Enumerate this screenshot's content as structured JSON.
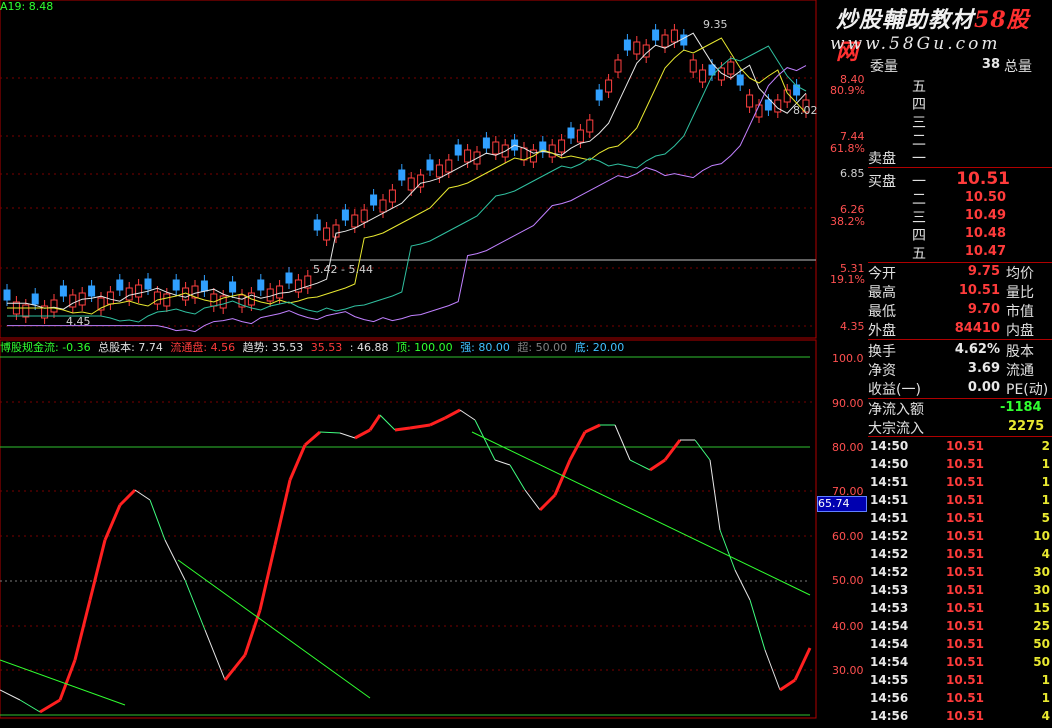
{
  "title_bar": {
    "label": "A19: 8.48"
  },
  "main_chart": {
    "y_labels": [
      {
        "price": "8.40",
        "pct": "80.9%"
      },
      {
        "price": "7.44",
        "pct": "61.8%"
      },
      {
        "price": "6.85",
        "pct": ""
      },
      {
        "price": "6.26",
        "pct": "38.2%"
      },
      {
        "price": "5.31",
        "pct": "19.1%"
      },
      {
        "price": "4.35",
        "pct": ""
      }
    ],
    "annotations": {
      "high": "9.35",
      "right_price": "8.02",
      "low": "4.45",
      "range": "5.42 - 5.44"
    }
  },
  "indicator": {
    "header": [
      {
        "text": "博股规金流: -0.36",
        "color": "#30ff30"
      },
      {
        "text": "总股本: 7.74",
        "color": "#e0e0e0"
      },
      {
        "text": "流通盘: 4.56",
        "color": "#ff3b3b"
      },
      {
        "text": "趋势: 35.53",
        "color": "#e0e0e0"
      },
      {
        "text": "35.53",
        "color": "#ff3b3b"
      },
      {
        "text": ": 46.88",
        "color": "#e0e0e0"
      },
      {
        "text": "顶: 100.00",
        "color": "#30ff30"
      },
      {
        "text": "强: 80.00",
        "color": "#40c0ff"
      },
      {
        "text": "超: 50.00",
        "color": "#808080"
      },
      {
        "text": "底: 20.00",
        "color": "#40c0ff"
      }
    ],
    "y_labels": [
      "100.0",
      "90.00",
      "80.00",
      "70.00",
      "60.00",
      "50.00",
      "40.00",
      "30.00"
    ],
    "current_value": "65.74"
  },
  "logo": {
    "line1_a": "炒股輔助教材",
    "line1_b": "58股网",
    "line2": "www.58Gu.com"
  },
  "order_book": {
    "volume_ratio_label": "委量",
    "volume_ratio_value": "38",
    "total_label": "总量",
    "sell_levels": [
      "五",
      "四",
      "三",
      "二",
      "一"
    ],
    "sell_label": "卖盘",
    "buy_label": "买盘",
    "buy_levels": [
      {
        "level": "一",
        "price": "10.51"
      },
      {
        "level": "二",
        "price": "10.50"
      },
      {
        "level": "三",
        "price": "10.49"
      },
      {
        "level": "四",
        "price": "10.48"
      },
      {
        "level": "五",
        "price": "10.47"
      }
    ]
  },
  "stats": [
    {
      "label": "今开",
      "value": "9.75",
      "right": "均价",
      "color": "red"
    },
    {
      "label": "最高",
      "value": "10.51",
      "right": "量比",
      "color": "red"
    },
    {
      "label": "最低",
      "value": "9.70",
      "right": "市值",
      "color": "red"
    },
    {
      "label": "外盘",
      "value": "84410",
      "right": "内盘",
      "color": "red"
    },
    {
      "label": "换手",
      "value": "4.62%",
      "right": "股本",
      "color": "white"
    },
    {
      "label": "净资",
      "value": "3.69",
      "right": "流通",
      "color": "white"
    },
    {
      "label": "收益(一)",
      "value": "0.00",
      "right": "PE(动)",
      "color": "white"
    }
  ],
  "flows": [
    {
      "label": "净流入额",
      "value": "-1184"
    },
    {
      "label": "大宗流入",
      "value": "2275"
    }
  ],
  "ticks": [
    {
      "time": "14:50",
      "price": "10.51",
      "vol": "2"
    },
    {
      "time": "14:50",
      "price": "10.51",
      "vol": "1"
    },
    {
      "time": "14:51",
      "price": "10.51",
      "vol": "1"
    },
    {
      "time": "14:51",
      "price": "10.51",
      "vol": "1"
    },
    {
      "time": "14:51",
      "price": "10.51",
      "vol": "5"
    },
    {
      "time": "14:52",
      "price": "10.51",
      "vol": "10"
    },
    {
      "time": "14:52",
      "price": "10.51",
      "vol": "4"
    },
    {
      "time": "14:52",
      "price": "10.51",
      "vol": "30"
    },
    {
      "time": "14:53",
      "price": "10.51",
      "vol": "30"
    },
    {
      "time": "14:53",
      "price": "10.51",
      "vol": "15"
    },
    {
      "time": "14:54",
      "price": "10.51",
      "vol": "25"
    },
    {
      "time": "14:54",
      "price": "10.51",
      "vol": "50"
    },
    {
      "time": "14:54",
      "price": "10.51",
      "vol": "50"
    },
    {
      "time": "14:55",
      "price": "10.51",
      "vol": "1"
    },
    {
      "time": "14:56",
      "price": "10.51",
      "vol": "1"
    },
    {
      "time": "14:56",
      "price": "10.51",
      "vol": "4"
    }
  ]
}
